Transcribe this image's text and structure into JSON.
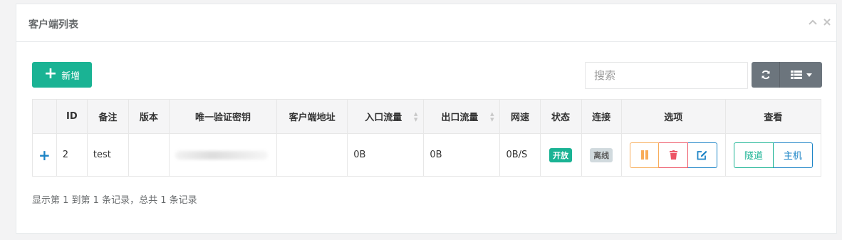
{
  "panel": {
    "title": "客户端列表"
  },
  "toolbar": {
    "add_label": "新增",
    "search_placeholder": "搜索"
  },
  "table": {
    "headers": [
      "",
      "ID",
      "备注",
      "版本",
      "唯一验证密钥",
      "客户端地址",
      "入口流量",
      "出口流量",
      "网速",
      "状态",
      "连接",
      "选项",
      "查看"
    ],
    "rows": [
      {
        "expand": "+",
        "id": "2",
        "remark": "test",
        "version": "",
        "key": "",
        "address": "",
        "in_flow": "0B",
        "out_flow": "0B",
        "speed": "0B/S",
        "status": "开放",
        "connect": "离线"
      }
    ],
    "view_buttons": {
      "tunnel": "隧道",
      "host": "主机"
    }
  },
  "pagination": {
    "info": "显示第 1 到第 1 条记录，总共 1 条记录"
  },
  "colors": {
    "primary": "#1ab394",
    "info": "#1c84c6",
    "warning": "#f8ac59",
    "danger": "#ed5565",
    "secondary": "#6c757d"
  }
}
